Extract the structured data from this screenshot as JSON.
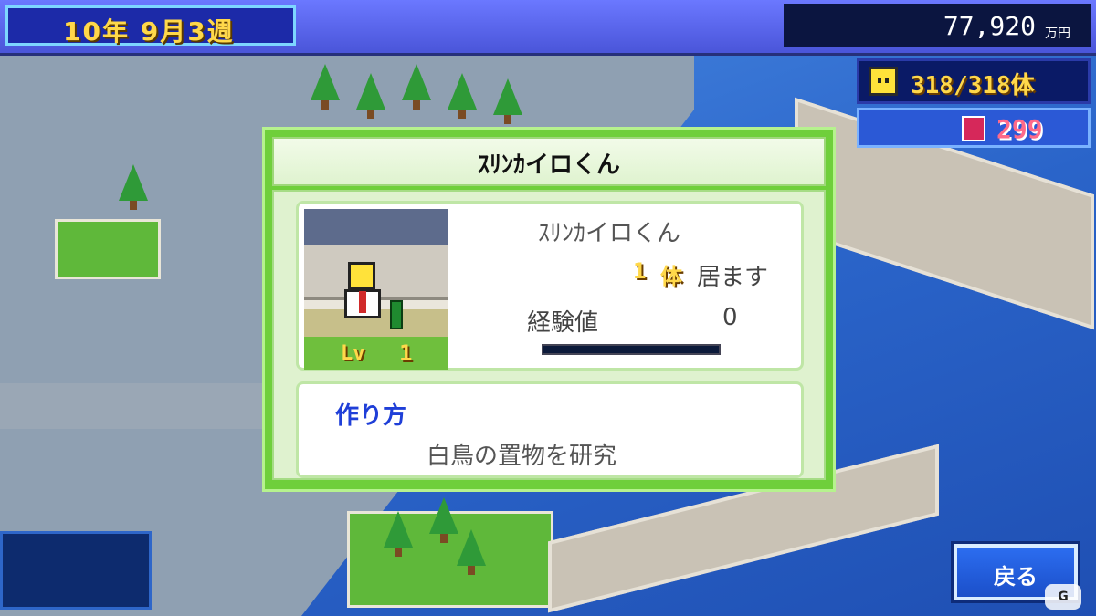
{
  "hud": {
    "date": "10年 9月3週",
    "money_value": "77,920",
    "money_unit": "万円",
    "population": "318/318体",
    "points": "299"
  },
  "dialog": {
    "title": "ｽﾘﾝｶイロくん",
    "character_name": "ｽﾘﾝｶイロくん",
    "count_number": "1",
    "count_unit": "体",
    "count_label": "居ます",
    "level_label": "Lv",
    "level_value": "1",
    "exp_label": "経験値",
    "exp_value": "0",
    "how_label": "作り方",
    "how_text": "白鳥の置物を研究"
  },
  "buttons": {
    "back": "戻る"
  },
  "icons": {
    "population": "kairo-face-icon",
    "points": "research-point-icon"
  },
  "colors": {
    "accent_blue": "#1f3fd8",
    "dialog_green": "#6fcf3b",
    "gold": "#ffd84a"
  }
}
